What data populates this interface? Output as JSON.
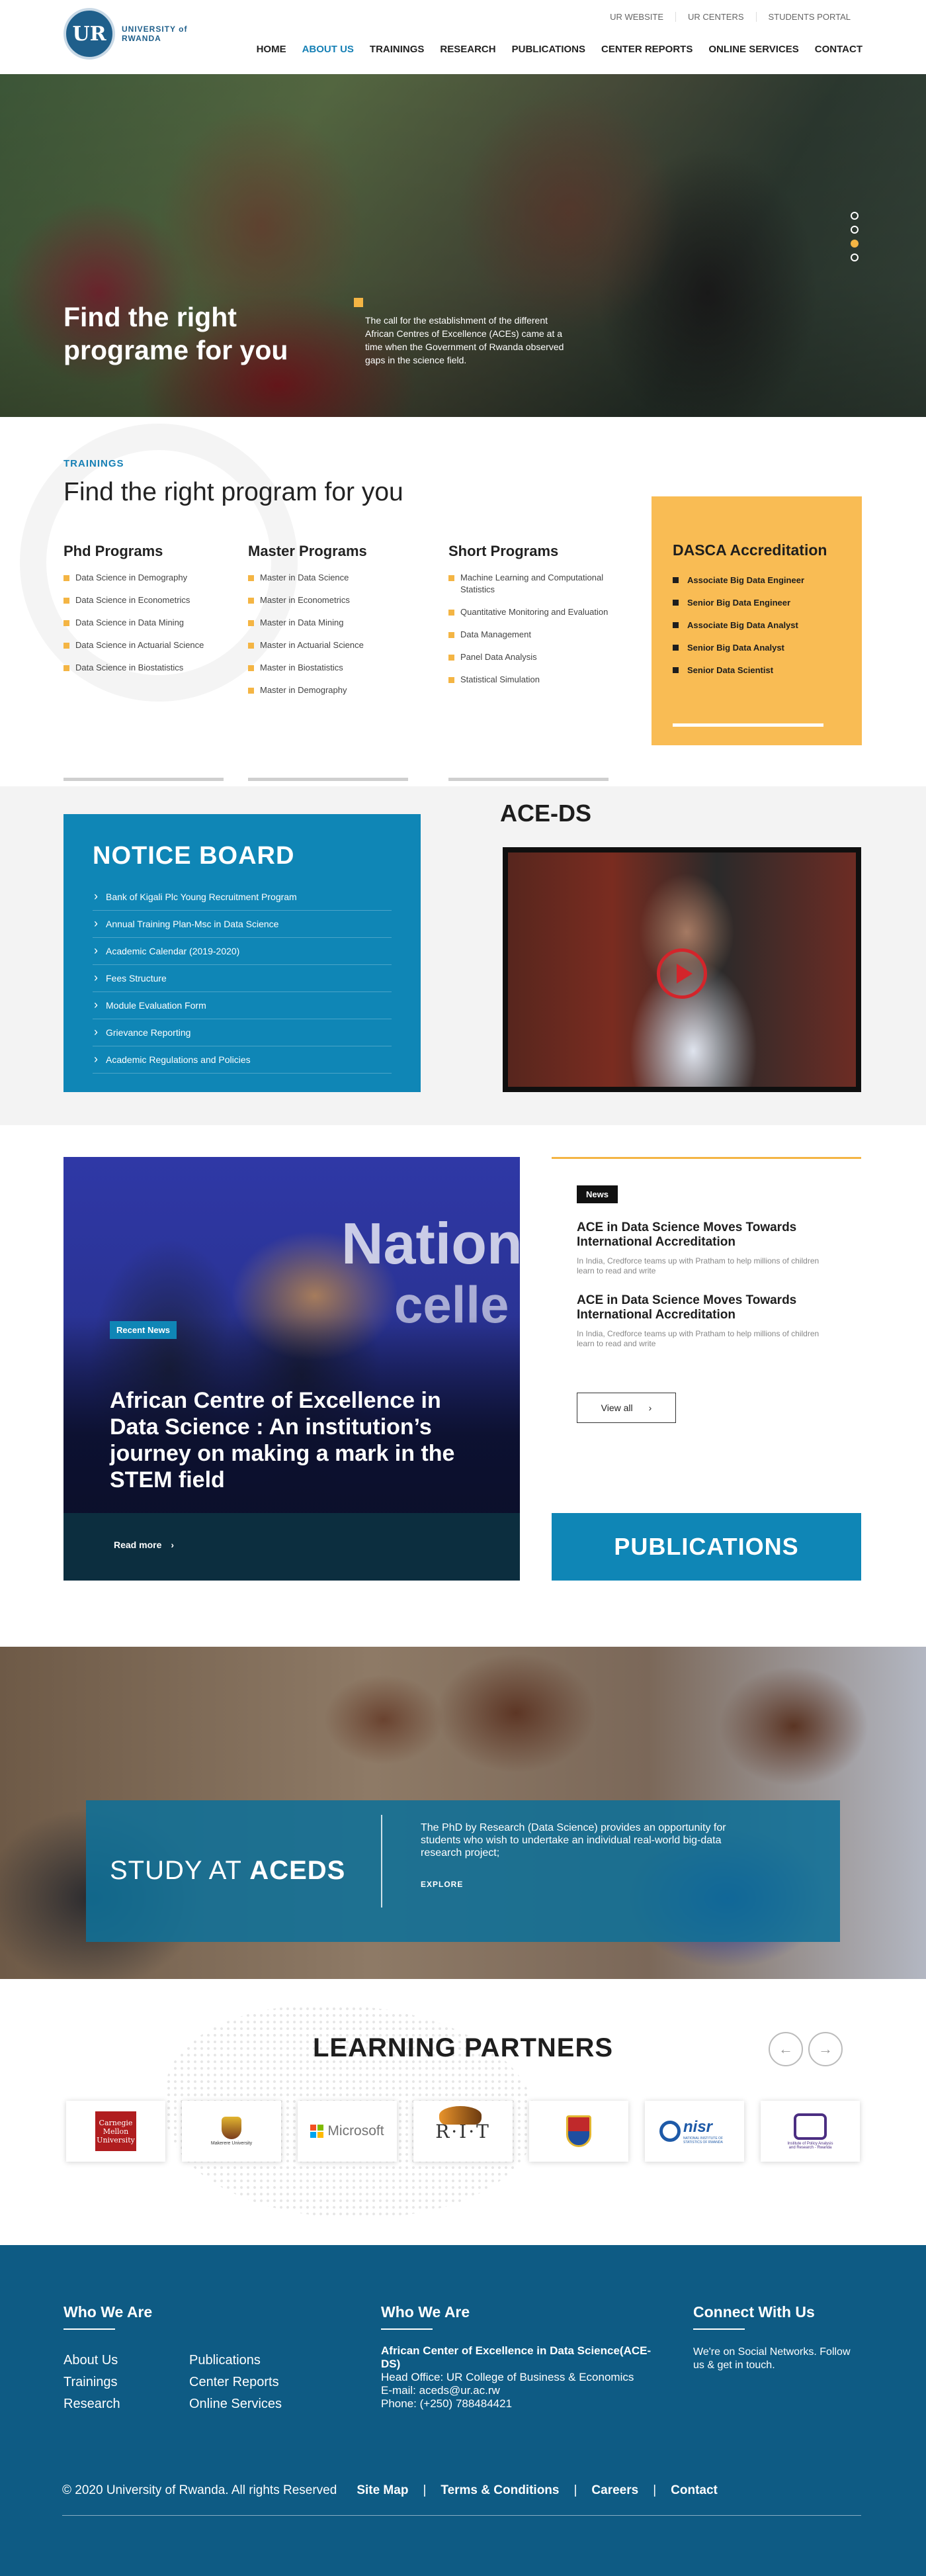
{
  "header": {
    "logo_mark": "UR",
    "logo_line1": "UNIVERSITY of",
    "logo_line2": "RWANDA",
    "top_links": [
      "UR WEBSITE",
      "UR CENTERS",
      "STUDENTS PORTAL"
    ],
    "nav": [
      "HOME",
      "ABOUT US",
      "TRAININGS",
      "RESEARCH",
      "PUBLICATIONS",
      "CENTER REPORTS",
      "ONLINE SERVICES",
      "CONTACT"
    ],
    "active_nav": "ABOUT US"
  },
  "hero": {
    "title": "Find the right programe for you",
    "copy": "The call for the establishment of the different African Centres of Excellence (ACEs) came at a time when the Government of Rwanda observed gaps in the science field.",
    "slides_count": 4,
    "active_slide": 3
  },
  "trainings": {
    "eyebrow": "TRAININGS",
    "title": "Find the right program for you",
    "phd": {
      "title": "Phd Programs",
      "items": [
        "Data Science in Demography",
        "Data Science in Econometrics",
        "Data Science in Data Mining",
        "Data Science in Actuarial Science",
        "Data Science in Biostatistics"
      ]
    },
    "master": {
      "title": "Master Programs",
      "items": [
        "Master in Data Science",
        "Master in Econometrics",
        "Master in Data Mining",
        "Master in Actuarial Science",
        "Master in Biostatistics",
        "Master in Demography"
      ]
    },
    "short": {
      "title": "Short Programs",
      "items": [
        "Machine Learning and Computational Statistics",
        "Quantitative Monitoring and Evaluation",
        "Data Management",
        "Panel Data Analysis",
        "Statistical Simulation"
      ]
    },
    "dasca": {
      "title": "DASCA Accreditation",
      "items": [
        "Associate Big Data Engineer",
        "Senior Big Data Engineer",
        "Associate Big Data Analyst",
        "Senior Big Data Analyst",
        "Senior Data Scientist"
      ]
    }
  },
  "notice_board": {
    "title": "NOTICE BOARD",
    "items": [
      "Bank of Kigali Plc Young Recruitment Program",
      "Annual Training Plan-Msc in Data Science",
      "Academic Calendar (2019-2020)",
      "Fees Structure",
      "Module Evaluation Form",
      "Grievance Reporting",
      "Academic Regulations and Policies"
    ]
  },
  "ace_ds": {
    "title": "ACE-DS"
  },
  "news": {
    "feature_tag": "Recent News",
    "feature_word1": "Nation",
    "feature_word2": "celle",
    "feature_title": "African Centre of Excellence in Data Science : An institution’s journey on making a mark in the STEM field",
    "read_more": "Read more",
    "badge": "News",
    "items": [
      {
        "title": "ACE in Data Science Moves Towards International Accreditation",
        "summary": "In India, Credforce teams up with Pratham to help millions of children learn to read and write"
      },
      {
        "title": "ACE in Data Science Moves Towards International Accreditation",
        "summary": "In India, Credforce teams up with Pratham to help millions of children learn to read and write"
      }
    ],
    "view_all": "View all",
    "publications": "PUBLICATIONS"
  },
  "study": {
    "title_light": "STUDY AT",
    "title_bold": "ACEDS",
    "copy": "The PhD by Research (Data Science) provides an opportunity for students who wish to  undertake an individual real-world big-data research project;",
    "explore": "EXPLORE"
  },
  "partners": {
    "title": "LEARNING PARTNERS",
    "cmu": "Carnegie Mellon University",
    "makerere": "Makerere University",
    "microsoft": "Microsoft",
    "rit": "R·I·T",
    "nisr": "nisr",
    "nisr_sub": "NATIONAL INSTITUTE OF STATISTICS OF RWANDA",
    "aims": "Institute of Policy Analysis and Research - Rwanda",
    "ms_colors": [
      "#f25022",
      "#7fba00",
      "#00a4ef",
      "#ffb900"
    ]
  },
  "footer": {
    "col1_title": "Who We Are",
    "links_a": [
      "About Us",
      "Trainings",
      "Research"
    ],
    "links_b": [
      "Publications",
      "Center Reports",
      "Online Services"
    ],
    "col2_title": "Who We Are",
    "org_name": "African Center of Excellence in Data Science(ACE-DS)",
    "office": "Head Office: UR College of Business & Economics",
    "email": "E-mail: aceds@ur.ac.rw",
    "phone": "Phone: (+250) 788484421",
    "col3_title": "Connect With Us",
    "connect_text": "We're on Social Networks. Follow us & get in touch.",
    "copyright": "© 2020 University of Rwanda. All rights Reserved",
    "bottom_links": [
      "Site Map",
      "Terms & Conditions",
      "Careers",
      "Contact"
    ],
    "separator": "|"
  }
}
